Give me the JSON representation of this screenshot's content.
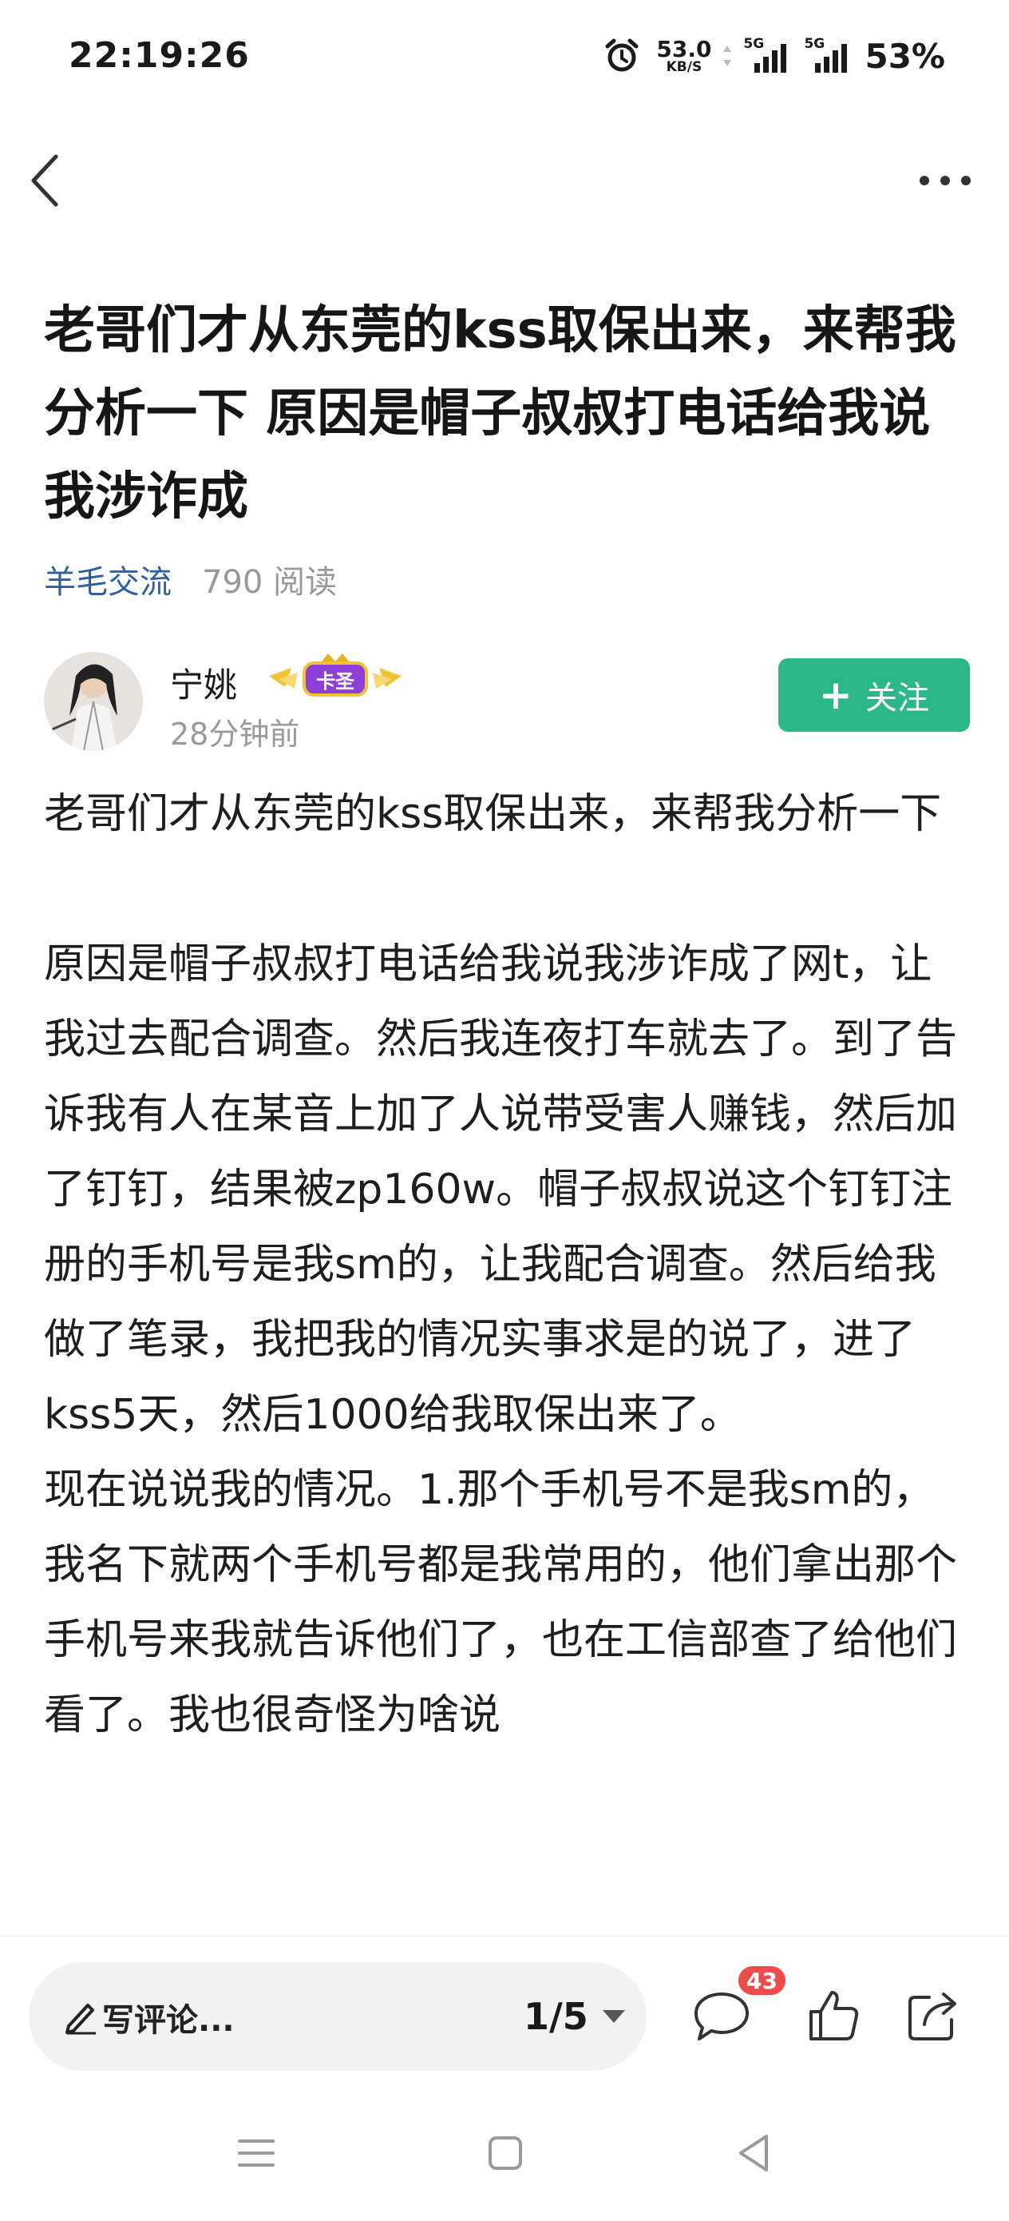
{
  "status_bar": {
    "time": "22:19:26",
    "net_speed": "53.0",
    "net_unit": "KB/S",
    "sim1_label": "5G",
    "sim2_label": "5G",
    "battery": "53%"
  },
  "nav": {
    "back_icon": "back-chevron-icon",
    "more_icon": "more-dots-icon"
  },
  "post": {
    "title": "老哥们才从东莞的kss取保出来，来帮我分析一下 原因是帽子叔叔打电话给我说我涉诈成",
    "category": "羊毛交流",
    "reads": "790 阅读",
    "author": {
      "name": "宁姚",
      "badge_text": "卡圣",
      "time": "28分钟前"
    },
    "follow_label": "关注",
    "follow_icon": "+",
    "paragraphs": [
      "老哥们才从东莞的kss取保出来，来帮我分析一下",
      "",
      "原因是帽子叔叔打电话给我说我涉诈成了网t，让我过去配合调查。然后我连夜打车就去了。到了告诉我有人在某音上加了人说带受害人赚钱，然后加了钉钉，结果被zp160w。帽子叔叔说这个钉钉注册的手机号是我sm的，让我配合调查。然后给我做了笔录，我把我的情况实事求是的说了，进了kss5天，然后1000给我取保出来了。",
      "现在说说我的情况。1.那个手机号不是我sm的，我名下就两个手机号都是我常用的，他们拿出那个手机号来我就告诉他们了，也在工信部查了给他们看了。我也很奇怪为啥说"
    ]
  },
  "bottom_bar": {
    "comment_placeholder": "写评论...",
    "page_indicator": "1/5",
    "comment_count": "43",
    "colors": {
      "accent": "#2cb789",
      "badge": "#f04b4b",
      "link": "#2f5f9e"
    }
  }
}
